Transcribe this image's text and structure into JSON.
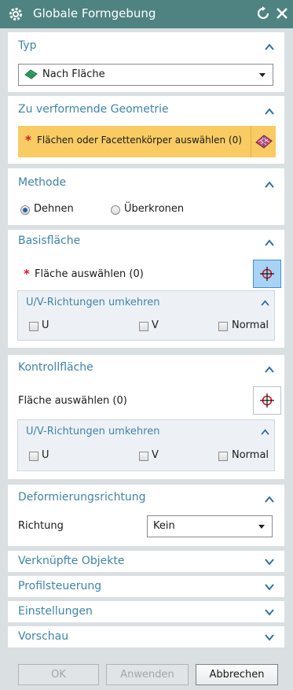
{
  "window": {
    "title": "Globale Formgebung",
    "titlebar_color": "#4f8382"
  },
  "typ": {
    "title": "Typ",
    "selected": "Nach Fläche"
  },
  "geometrie": {
    "title": "Zu verformende Geometrie",
    "required_marker": "*",
    "prompt": "Flächen oder Facettenkörper auswählen (0)",
    "highlight_color": "#f9cb63"
  },
  "methode": {
    "title": "Methode",
    "options": [
      "Dehnen",
      "Überkronen"
    ],
    "selected": "Dehnen"
  },
  "basisflaeche": {
    "title": "Basisfläche",
    "required_marker": "*",
    "prompt": "Fläche auswählen (0)",
    "sub": {
      "title": "U/V-Richtungen umkehren",
      "checks": [
        "U",
        "V",
        "Normal"
      ]
    }
  },
  "kontrollflaeche": {
    "title": "Kontrollfläche",
    "prompt": "Fläche auswählen (0)",
    "sub": {
      "title": "U/V-Richtungen umkehren",
      "checks": [
        "U",
        "V",
        "Normal"
      ]
    }
  },
  "deformierung": {
    "title": "Deformierungsrichtung",
    "label": "Richtung",
    "selected": "Kein"
  },
  "collapsed_sections": [
    "Verknüpfte Objekte",
    "Profilsteuerung",
    "Einstellungen",
    "Vorschau"
  ],
  "buttons": {
    "ok": "OK",
    "apply": "Anwenden",
    "cancel": "Abbrechen"
  },
  "colors": {
    "section_title": "#3f84a8",
    "selected_pick": "#a8d3f5"
  }
}
